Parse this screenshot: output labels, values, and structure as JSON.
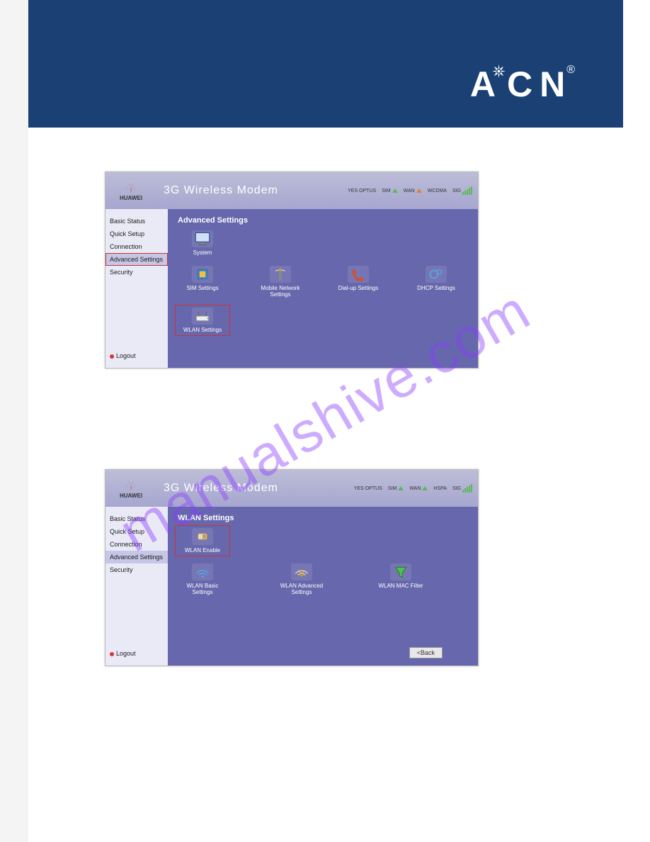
{
  "brand": "ACN",
  "watermark": "manualshive.com",
  "modem": {
    "vendor": "HUAWEI",
    "title": "3G Wireless Modem",
    "status": {
      "carrier": "YES OPTUS",
      "sim": "SIM",
      "wan": "WAN",
      "mode1": "WCDMA",
      "mode2": "HSPA",
      "sig": "SIG"
    }
  },
  "nav": [
    "Basic Status",
    "Quick Setup",
    "Connection",
    "Advanced Settings",
    "Security"
  ],
  "logout": "Logout",
  "screen1": {
    "header": "Advanced Settings",
    "tiles": [
      [
        "System"
      ],
      [
        "SIM Settings",
        "Mobile Network Settings",
        "Dial-up Settings",
        "DHCP Settings"
      ],
      [
        "WLAN Settings"
      ]
    ]
  },
  "screen2": {
    "header": "WLAN Settings",
    "tiles": [
      [
        "WLAN Enable"
      ],
      [
        "WLAN Basic Settings",
        "WLAN Advanced Settings",
        "WLAN MAC Filter"
      ]
    ],
    "back": "<Back"
  }
}
